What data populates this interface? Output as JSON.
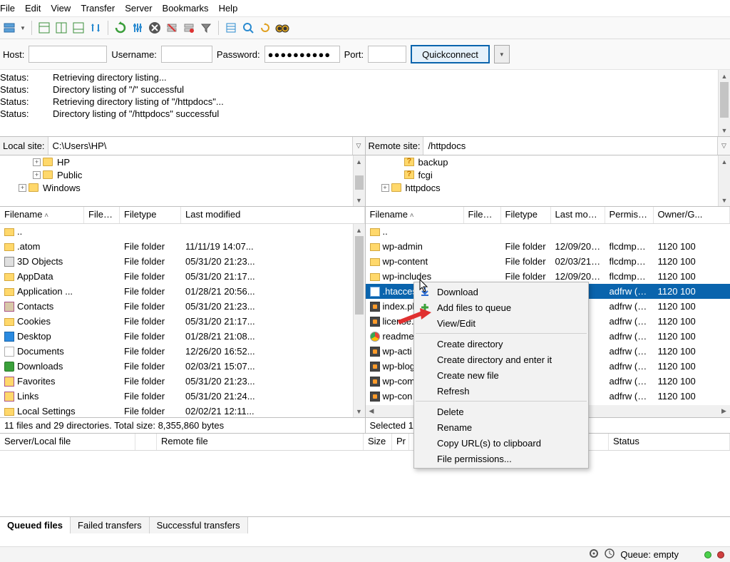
{
  "menu": [
    "File",
    "Edit",
    "View",
    "Transfer",
    "Server",
    "Bookmarks",
    "Help"
  ],
  "conn": {
    "host_label": "Host:",
    "user_label": "Username:",
    "pass_label": "Password:",
    "port_label": "Port:",
    "pass_value": "●●●●●●●●●●",
    "quickconnect": "Quickconnect"
  },
  "status": [
    {
      "label": "Status:",
      "msg": "Retrieving directory listing..."
    },
    {
      "label": "Status:",
      "msg": "Directory listing of \"/\" successful"
    },
    {
      "label": "Status:",
      "msg": "Retrieving directory listing of \"/httpdocs\"..."
    },
    {
      "label": "Status:",
      "msg": "Directory listing of \"/httpdocs\" successful"
    }
  ],
  "local": {
    "label": "Local site:",
    "path": "C:\\Users\\HP\\",
    "tree": [
      {
        "indent": 46,
        "exp": "+",
        "icon": "folder",
        "name": "HP"
      },
      {
        "indent": 46,
        "exp": "+",
        "icon": "folder",
        "name": "Public"
      },
      {
        "indent": 26,
        "exp": "+",
        "icon": "folder",
        "name": "Windows"
      }
    ],
    "cols": {
      "filename": "Filename",
      "filesize": "Filesize",
      "filetype": "Filetype",
      "modified": "Last modified"
    },
    "rows": [
      {
        "icon": "folder",
        "name": "..",
        "type": "",
        "mod": ""
      },
      {
        "icon": "folder",
        "name": ".atom",
        "type": "File folder",
        "mod": "11/11/19 14:07..."
      },
      {
        "icon": "drive",
        "name": "3D Objects",
        "type": "File folder",
        "mod": "05/31/20 21:23..."
      },
      {
        "icon": "folder",
        "name": "AppData",
        "type": "File folder",
        "mod": "05/31/20 21:17..."
      },
      {
        "icon": "folder",
        "name": "Application ...",
        "type": "File folder",
        "mod": "01/28/21 20:56..."
      },
      {
        "icon": "contacts",
        "name": "Contacts",
        "type": "File folder",
        "mod": "05/31/20 21:23..."
      },
      {
        "icon": "folder",
        "name": "Cookies",
        "type": "File folder",
        "mod": "05/31/20 21:17..."
      },
      {
        "icon": "desktop",
        "name": "Desktop",
        "type": "File folder",
        "mod": "01/28/21 21:08..."
      },
      {
        "icon": "generic",
        "name": "Documents",
        "type": "File folder",
        "mod": "12/26/20 16:52..."
      },
      {
        "icon": "down",
        "name": "Downloads",
        "type": "File folder",
        "mod": "02/03/21 15:07..."
      },
      {
        "icon": "fav",
        "name": "Favorites",
        "type": "File folder",
        "mod": "05/31/20 21:23..."
      },
      {
        "icon": "fav",
        "name": "Links",
        "type": "File folder",
        "mod": "05/31/20 21:24..."
      },
      {
        "icon": "folder",
        "name": "Local Settings",
        "type": "File folder",
        "mod": "02/02/21 12:11..."
      }
    ],
    "status": "11 files and 29 directories. Total size: 8,355,860 bytes"
  },
  "remote": {
    "label": "Remote site:",
    "path": "/httpdocs",
    "tree": [
      {
        "indent": 40,
        "exp": "",
        "icon": "folder-q",
        "name": "backup"
      },
      {
        "indent": 40,
        "exp": "",
        "icon": "folder-q",
        "name": "fcgi"
      },
      {
        "indent": 22,
        "exp": "+",
        "icon": "folder",
        "name": "httpdocs"
      }
    ],
    "cols": {
      "filename": "Filename",
      "filesize": "Filesize",
      "filetype": "Filetype",
      "modified": "Last modifi...",
      "perm": "Permissi...",
      "owner": "Owner/G..."
    },
    "rows": [
      {
        "icon": "folder",
        "name": "..",
        "size": "",
        "type": "",
        "mod": "",
        "perm": "",
        "owner": ""
      },
      {
        "icon": "folder",
        "name": "wp-admin",
        "size": "",
        "type": "File folder",
        "mod": "12/09/20 1...",
        "perm": "flcdmpe ...",
        "owner": "1120 100"
      },
      {
        "icon": "folder",
        "name": "wp-content",
        "size": "",
        "type": "File folder",
        "mod": "02/03/21 1...",
        "perm": "flcdmpe ...",
        "owner": "1120 100"
      },
      {
        "icon": "folder",
        "name": "wp-includes",
        "size": "",
        "type": "File folder",
        "mod": "12/09/20 1...",
        "perm": "flcdmpe ...",
        "owner": "1120 100"
      },
      {
        "icon": "page",
        "name": ".htaccess",
        "size": "",
        "type": "",
        "mod": "21 1...",
        "perm": "adfrw (0...",
        "owner": "1120 100",
        "selected": true
      },
      {
        "icon": "sublime",
        "name": "index.ph",
        "size": "",
        "type": "",
        "mod": "20 1...",
        "perm": "adfrw (0...",
        "owner": "1120 100"
      },
      {
        "icon": "sublime",
        "name": "license.t",
        "size": "",
        "type": "",
        "mod": "20 1...",
        "perm": "adfrw (0...",
        "owner": "1120 100"
      },
      {
        "icon": "chrome",
        "name": "readme",
        "size": "",
        "type": "",
        "mod": "20 1...",
        "perm": "adfrw (0...",
        "owner": "1120 100"
      },
      {
        "icon": "sublime",
        "name": "wp-acti",
        "size": "",
        "type": "",
        "mod": "20 1...",
        "perm": "adfrw (0...",
        "owner": "1120 100"
      },
      {
        "icon": "sublime",
        "name": "wp-blog",
        "size": "",
        "type": "",
        "mod": "20 1...",
        "perm": "adfrw (0...",
        "owner": "1120 100"
      },
      {
        "icon": "sublime",
        "name": "wp-com",
        "size": "",
        "type": "",
        "mod": "20 1...",
        "perm": "adfrw (0...",
        "owner": "1120 100"
      },
      {
        "icon": "sublime",
        "name": "wp-con",
        "size": "",
        "type": "",
        "mod": "20 1...",
        "perm": "adfrw (0...",
        "owner": "1120 100"
      }
    ],
    "status": "Selected 1 f"
  },
  "ctx": {
    "items": [
      {
        "label": "Download",
        "icon": "down-blue"
      },
      {
        "label": "Add files to queue",
        "icon": "plus-green"
      },
      {
        "label": "View/Edit",
        "icon": ""
      },
      {
        "sep": true
      },
      {
        "label": "Create directory"
      },
      {
        "label": "Create directory and enter it"
      },
      {
        "label": "Create new file"
      },
      {
        "label": "Refresh"
      },
      {
        "sep": true
      },
      {
        "label": "Delete"
      },
      {
        "label": "Rename"
      },
      {
        "label": "Copy URL(s) to clipboard"
      },
      {
        "label": "File permissions..."
      }
    ]
  },
  "transfer": {
    "cols": [
      "Server/Local file",
      "",
      "Remote file",
      "Size",
      "Pr",
      "",
      "Status"
    ],
    "tabs": [
      "Queued files",
      "Failed transfers",
      "Successful transfers"
    ]
  },
  "footer": {
    "queue": "Queue: empty"
  }
}
